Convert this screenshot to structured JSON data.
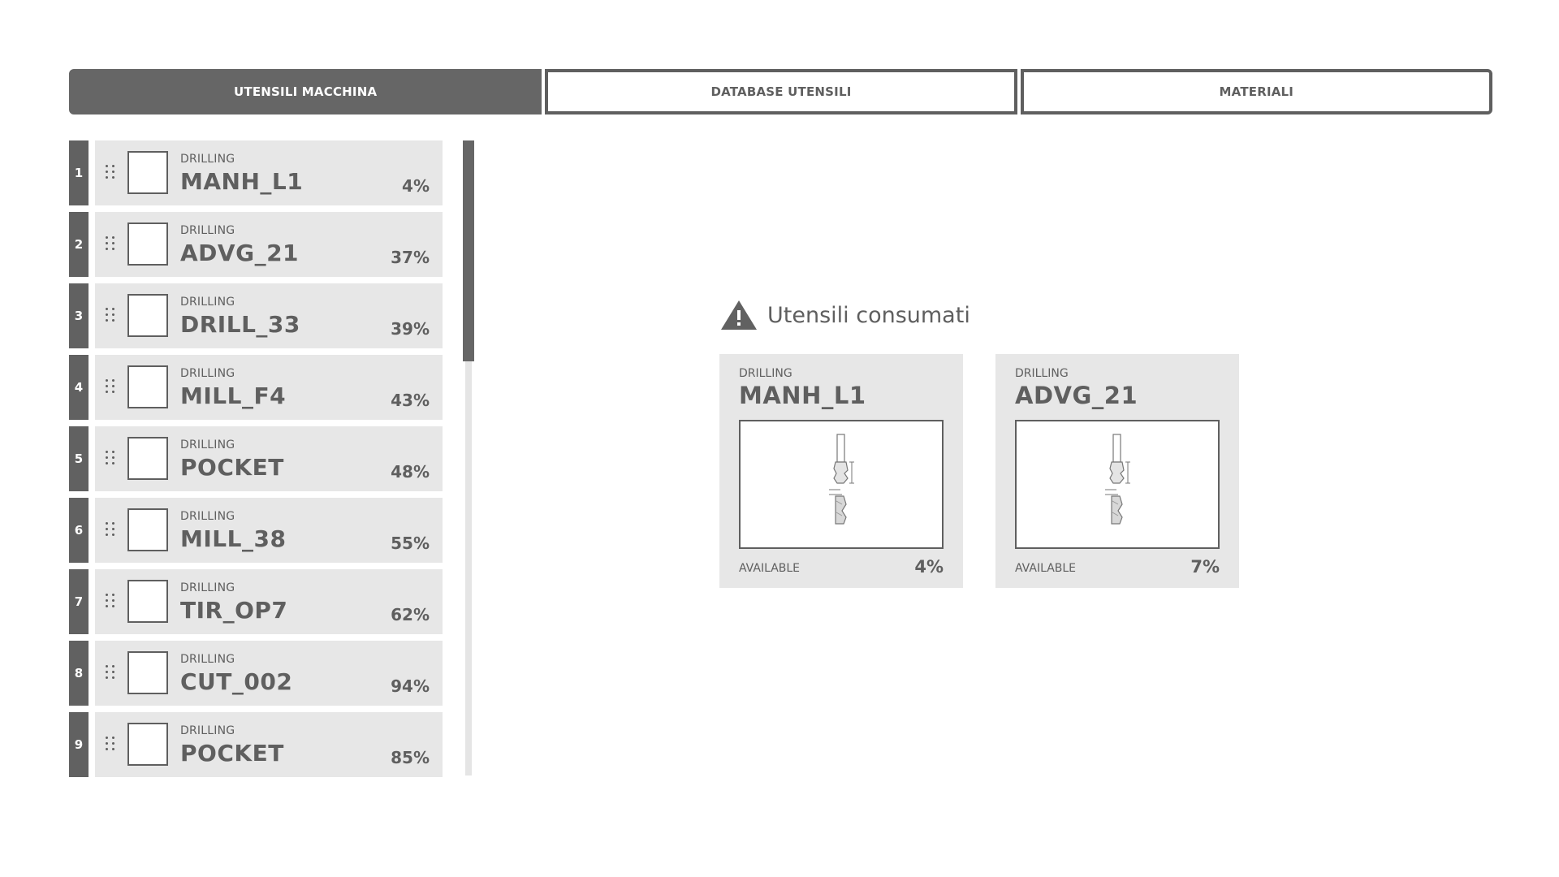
{
  "tabs": [
    {
      "label": "UTENSILI MACCHINA",
      "active": true
    },
    {
      "label": "DATABASE UTENSILI",
      "active": false
    },
    {
      "label": "MATERIALI",
      "active": false
    }
  ],
  "tool_list": [
    {
      "index": "1",
      "category": "DRILLING",
      "name": "MANH_L1",
      "percent": "4%"
    },
    {
      "index": "2",
      "category": "DRILLING",
      "name": "ADVG_21",
      "percent": "37%"
    },
    {
      "index": "3",
      "category": "DRILLING",
      "name": "DRILL_33",
      "percent": "39%"
    },
    {
      "index": "4",
      "category": "DRILLING",
      "name": "MILL_F4",
      "percent": "43%"
    },
    {
      "index": "5",
      "category": "DRILLING",
      "name": "POCKET",
      "percent": "48%"
    },
    {
      "index": "6",
      "category": "DRILLING",
      "name": "MILL_38",
      "percent": "55%"
    },
    {
      "index": "7",
      "category": "DRILLING",
      "name": "TIR_OP7",
      "percent": "62%"
    },
    {
      "index": "8",
      "category": "DRILLING",
      "name": "CUT_002",
      "percent": "94%"
    },
    {
      "index": "9",
      "category": "DRILLING",
      "name": "POCKET",
      "percent": "85%"
    }
  ],
  "consumed": {
    "title": "Utensili consumati",
    "icon": "warning-icon",
    "cards": [
      {
        "category": "DRILLING",
        "name": "MANH_L1",
        "available_label": "AVAILABLE",
        "percent": "4%",
        "image": "drill-bit-diagram"
      },
      {
        "category": "DRILLING",
        "name": "ADVG_21",
        "available_label": "AVAILABLE",
        "percent": "7%",
        "image": "drill-bit-diagram"
      }
    ]
  },
  "colors": {
    "primary_gray": "#666666",
    "card_background": "#e7e7e7",
    "text": "#5f5f5f",
    "background": "#ffffff"
  }
}
